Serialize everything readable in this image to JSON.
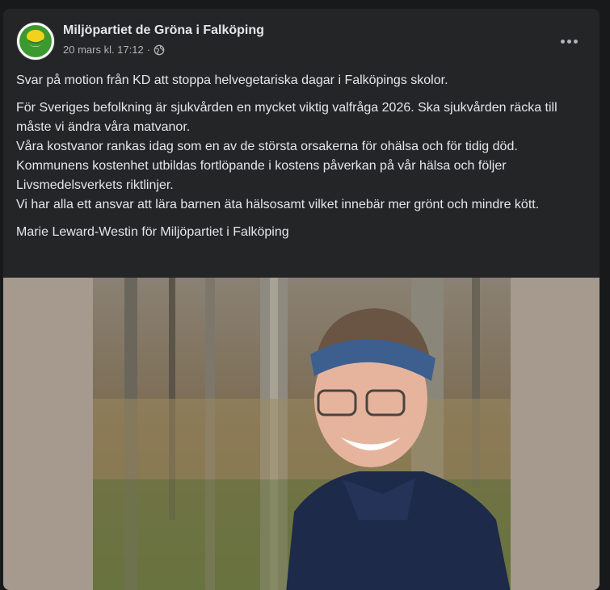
{
  "post": {
    "page_name": "Miljöpartiet de Gröna i Falköping",
    "timestamp": "20 mars kl. 17:12",
    "separator": "·",
    "privacy_icon": "globe-icon",
    "more_icon": "more-options-icon",
    "avatar_icon": "dandelion-logo-icon",
    "paragraphs": [
      "Svar på motion från KD att stoppa  helvegetariska dagar i Falköpings skolor.",
      "För Sveriges befolkning är sjukvården en mycket viktig valfråga 2026. Ska sjukvården räcka till måste vi ändra våra matvanor.\nVåra kostvanor rankas idag som en av de största orsakerna för ohälsa och för tidig död. Kommunens kostenhet utbildas fortlöpande i kostens påverkan på vår hälsa och följer Livsmedelsverkets riktlinjer.\nVi har alla ett ansvar att lära barnen äta hälsosamt vilket innebär mer grönt och mindre kött.",
      "Marie Leward-Westin för Miljöpartiet i Falköping"
    ]
  },
  "colors": {
    "card_bg": "#242526",
    "page_bg": "#18191a",
    "text_primary": "#e4e6eb",
    "text_secondary": "#b0b3b8",
    "brand_green": "#3a9a2f",
    "brand_yellow": "#f2d21b",
    "photo_side": "#a59a8d"
  }
}
